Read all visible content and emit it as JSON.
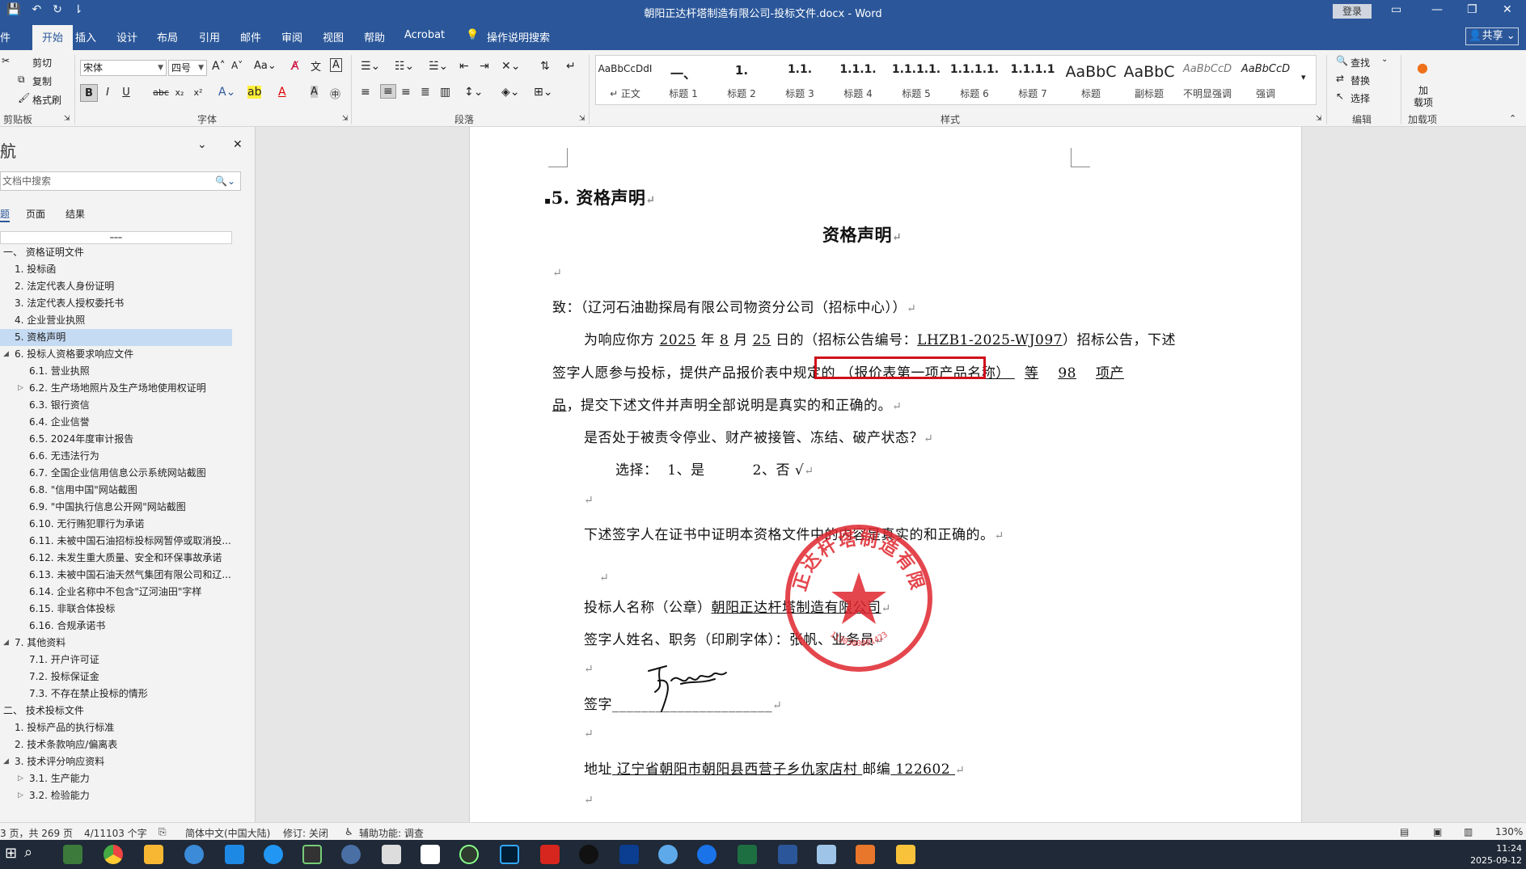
{
  "titlebar": {
    "title": "朝阳正达杆塔制造有限公司-投标文件.docx - Word",
    "login": "登录",
    "qat": [
      "💾",
      "↶",
      "↻",
      "⇂"
    ]
  },
  "ribbon_tabs": {
    "file": "件",
    "home": "开始",
    "insert": "插入",
    "design": "设计",
    "layout": "布局",
    "references": "引用",
    "mailings": "邮件",
    "review": "审阅",
    "view": "视图",
    "help": "帮助",
    "acrobat": "Acrobat",
    "tell_me": "操作说明搜索",
    "share": "共享"
  },
  "clipboard": {
    "cut": "剪切",
    "copy": "复制",
    "format_painter": "格式刷",
    "label": "剪贴板"
  },
  "font": {
    "name": "宋体",
    "size": "四号",
    "label": "字体",
    "bold": "B",
    "italic": "I",
    "underline": "U",
    "strike": "abc",
    "sub": "x₂",
    "sup": "x²"
  },
  "paragraph": {
    "label": "段落"
  },
  "styles": {
    "label": "样式",
    "items": [
      {
        "sample": "AaBbCcDdI",
        "name": "↵ 正文"
      },
      {
        "sample": "一、",
        "name": "标题 1"
      },
      {
        "sample": "1.",
        "name": "标题 2"
      },
      {
        "sample": "1.1.",
        "name": "标题 3"
      },
      {
        "sample": "1.1.1.",
        "name": "标题 4"
      },
      {
        "sample": "1.1.1.1.",
        "name": "标题 5"
      },
      {
        "sample": "1.1.1.1.",
        "name": "标题 6"
      },
      {
        "sample": "1.1.1.1",
        "name": "标题 7"
      },
      {
        "sample": "AaBbC",
        "name": "标题"
      },
      {
        "sample": "AaBbC",
        "name": "副标题"
      },
      {
        "sample": "AaBbCcD",
        "name": "不明显强调"
      },
      {
        "sample": "AaBbCcD",
        "name": "强调"
      }
    ]
  },
  "editing": {
    "find": "查找",
    "replace": "替换",
    "select": "选择",
    "label": "编辑"
  },
  "addins": {
    "line1": "加",
    "line2": "载项",
    "label": "加载项"
  },
  "nav": {
    "title": "航",
    "search_placeholder": "文档中搜索",
    "tabs": [
      "题",
      "页面",
      "结果"
    ],
    "items": [
      {
        "text": "一、 资格证明文件",
        "level": 0,
        "tri": ""
      },
      {
        "text": "1. 投标函",
        "level": 1,
        "tri": ""
      },
      {
        "text": "2. 法定代表人身份证明",
        "level": 1,
        "tri": ""
      },
      {
        "text": "3. 法定代表人授权委托书",
        "level": 1,
        "tri": ""
      },
      {
        "text": "4. 企业营业执照",
        "level": 1,
        "tri": ""
      },
      {
        "text": "5. 资格声明",
        "level": 1,
        "tri": "",
        "selected": true
      },
      {
        "text": "6. 投标人资格要求响应文件",
        "level": 1,
        "tri": "◢"
      },
      {
        "text": "6.1. 营业执照",
        "level": 2,
        "tri": ""
      },
      {
        "text": "6.2. 生产场地照片及生产场地使用权证明",
        "level": 2,
        "tri": "▷"
      },
      {
        "text": "6.3. 银行资信",
        "level": 2,
        "tri": ""
      },
      {
        "text": "6.4. 企业信誉",
        "level": 2,
        "tri": ""
      },
      {
        "text": "6.5. 2024年度审计报告",
        "level": 2,
        "tri": ""
      },
      {
        "text": "6.6. 无违法行为",
        "level": 2,
        "tri": ""
      },
      {
        "text": "6.7. 全国企业信用信息公示系统网站截图",
        "level": 2,
        "tri": ""
      },
      {
        "text": "6.8. \"信用中国\"网站截图",
        "level": 2,
        "tri": ""
      },
      {
        "text": "6.9. \"中国执行信息公开网\"网站截图",
        "level": 2,
        "tri": ""
      },
      {
        "text": "6.10. 无行贿犯罪行为承诺",
        "level": 2,
        "tri": ""
      },
      {
        "text": "6.11. 未被中国石油招标投标网暂停或取消投...",
        "level": 2,
        "tri": ""
      },
      {
        "text": "6.12. 未发生重大质量、安全和环保事故承诺",
        "level": 2,
        "tri": ""
      },
      {
        "text": "6.13. 未被中国石油天然气集团有限公司和辽...",
        "level": 2,
        "tri": ""
      },
      {
        "text": "6.14. 企业名称中不包含\"辽河油田\"字样",
        "level": 2,
        "tri": ""
      },
      {
        "text": "6.15. 非联合体投标",
        "level": 2,
        "tri": ""
      },
      {
        "text": "6.16. 合规承诺书",
        "level": 2,
        "tri": ""
      },
      {
        "text": "7. 其他资料",
        "level": 1,
        "tri": "◢"
      },
      {
        "text": "7.1. 开户许可证",
        "level": 2,
        "tri": ""
      },
      {
        "text": "7.2. 投标保证金",
        "level": 2,
        "tri": ""
      },
      {
        "text": "7.3. 不存在禁止投标的情形",
        "level": 2,
        "tri": ""
      },
      {
        "text": "二、 技术投标文件",
        "level": 0,
        "tri": ""
      },
      {
        "text": "1. 投标产品的执行标准",
        "level": 1,
        "tri": ""
      },
      {
        "text": "2. 技术条款响应/偏离表",
        "level": 1,
        "tri": ""
      },
      {
        "text": "3. 技术评分响应资料",
        "level": 1,
        "tri": "◢"
      },
      {
        "text": "3.1. 生产能力",
        "level": 2,
        "tri": "▷"
      },
      {
        "text": "3.2. 检验能力",
        "level": 2,
        "tri": "▷"
      }
    ]
  },
  "doc": {
    "heading": "5. 资格声明",
    "title": "资格声明",
    "to_line": "致：（辽河石油勘探局有限公司物资分公司（招标中心））",
    "p1_a": "为响应你方 ",
    "p1_year": "2025",
    "p1_b": " 年 ",
    "p1_month": "8",
    "p1_c": " 月 ",
    "p1_day": "25",
    "p1_d": " 日的（招标公告编号：",
    "p1_code": "LHZB1-2025-WJ097",
    "p1_e": "）招标公告，下述",
    "p2_a": "签字人愿参与投标，提供产品报价表中规定的",
    "p2_product": " （报价表第一项产品名称） ",
    "p2_b": "等",
    "p2_count": "98",
    "p2_c": "项产",
    "p3_a": "品",
    "p3_b": "，提交下述文件并声明全部说明是真实的和正确的。",
    "q1": "是否处于被责令停业、财产被接管、冻结、破产状态？",
    "choice": "选择：  1、是          2、否 √",
    "statement": "下述签字人在证书中证明本资格文件中的内容是真实的和正确的。",
    "bidder_label": "投标人名称（公章）",
    "bidder_name": "朝阳正达杆塔制造有限公司",
    "signer_line": "签字人姓名、职务（印刷字体）：张帆、业务员",
    "sign_label": "签字",
    "sign_blank": "______________________",
    "address_label": "地址",
    "address": " 辽宁省朝阳市朝阳县西营子乡仇家店村 ",
    "zip_label": "邮编",
    "zip": " 122602 ",
    "para_mark": "↵",
    "stamp_text": "朝阳正达杆塔制造有限公司",
    "stamp_number": "1130300001423",
    "signature_text": "张帆"
  },
  "status": {
    "page": "3 页，共 269 页",
    "words": "4/11103 个字",
    "lang": "简体中文(中国大陆)",
    "track": "修订: 关闭",
    "access": "辅助功能: 调查",
    "zoom": "130%"
  },
  "taskbar": {
    "time": "11:24",
    "date": "2025-09-12"
  },
  "colors": {
    "accent": "#2b579a",
    "highlight_box": "#d0101a",
    "stamp": "#e0262e"
  }
}
